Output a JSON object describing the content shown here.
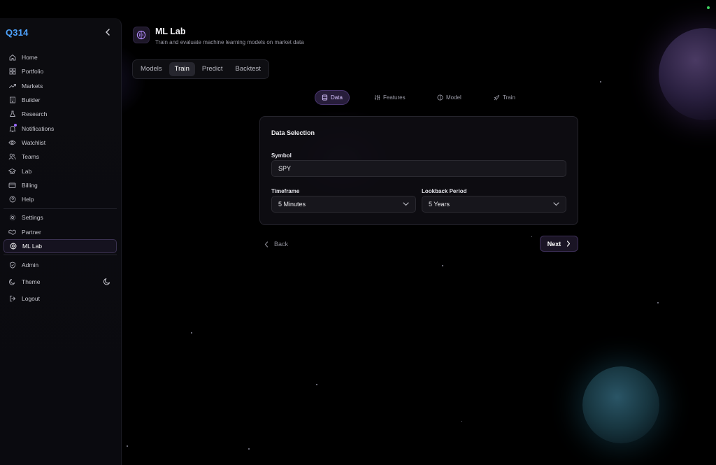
{
  "app": {
    "brand": "Q314"
  },
  "sidebar": {
    "items": [
      {
        "label": "Home",
        "icon": "home-icon"
      },
      {
        "label": "Portfolio",
        "icon": "grid-icon"
      },
      {
        "label": "Markets",
        "icon": "trend-icon"
      },
      {
        "label": "Builder",
        "icon": "building-icon"
      },
      {
        "label": "Research",
        "icon": "flask-icon"
      },
      {
        "label": "Notifications",
        "icon": "bell-icon"
      },
      {
        "label": "Watchlist",
        "icon": "eye-icon"
      },
      {
        "label": "Teams",
        "icon": "users-icon"
      },
      {
        "label": "Lab",
        "icon": "graduation-cap-icon"
      },
      {
        "label": "Billing",
        "icon": "credit-card-icon"
      },
      {
        "label": "Help",
        "icon": "help-circle-icon"
      }
    ],
    "items2": [
      {
        "label": "Settings",
        "icon": "gear-icon"
      },
      {
        "label": "Partner",
        "icon": "handshake-icon"
      },
      {
        "label": "ML Lab",
        "icon": "brain-icon",
        "active": true
      }
    ],
    "items3": [
      {
        "label": "Admin",
        "icon": "shield-icon"
      },
      {
        "label": "Theme",
        "icon": "moon-icon"
      },
      {
        "label": "Logout",
        "icon": "logout-icon"
      }
    ]
  },
  "header": {
    "title": "ML Lab",
    "subtitle": "Train and evaluate machine learning models on market data"
  },
  "tabs": [
    {
      "label": "Models"
    },
    {
      "label": "Train",
      "active": true
    },
    {
      "label": "Predict"
    },
    {
      "label": "Backtest"
    }
  ],
  "stepper": [
    {
      "label": "Data",
      "icon": "database-icon",
      "active": true
    },
    {
      "label": "Features",
      "icon": "sliders-icon"
    },
    {
      "label": "Model",
      "icon": "brain-icon"
    },
    {
      "label": "Train",
      "icon": "rocket-icon"
    }
  ],
  "card": {
    "title": "Data Selection",
    "symbol": {
      "label": "Symbol",
      "value": "SPY"
    },
    "timeframe": {
      "label": "Timeframe",
      "value": "5 Minutes"
    },
    "lookback": {
      "label": "Lookback Period",
      "value": "5 Years"
    }
  },
  "nav_buttons": {
    "back": "Back",
    "next": "Next"
  },
  "colors": {
    "accent": "#9b6bff",
    "brand": "#4ea3ff",
    "status": "#3ecf5f"
  }
}
